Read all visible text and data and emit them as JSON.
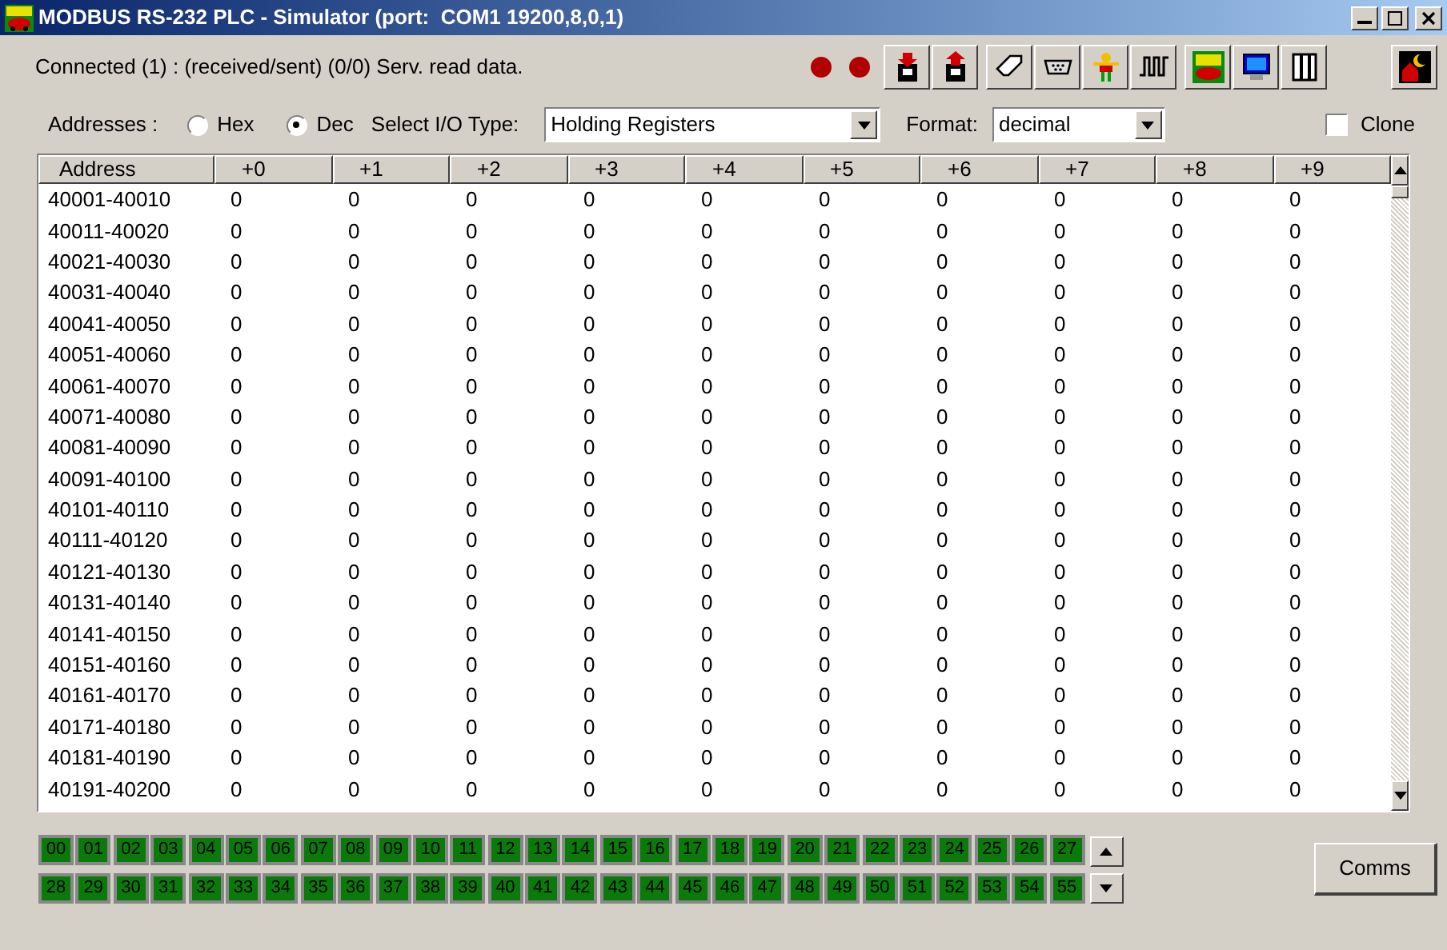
{
  "window": {
    "title": "MODBUS RS-232 PLC - Simulator (port:  COM1 19200,8,0,1)"
  },
  "status": {
    "text": "Connected (1) : (received/sent) (0/0) Serv. read data."
  },
  "options": {
    "addresses_label": "Addresses :",
    "radios": [
      {
        "label": "Hex",
        "selected": false
      },
      {
        "label": "Dec",
        "selected": true
      }
    ],
    "io_type_label": "Select I/O Type:",
    "io_type": "Holding Registers",
    "format_label": "Format:",
    "format": "decimal",
    "clone": {
      "label": "Clone",
      "checked": false
    }
  },
  "table": {
    "columns": [
      "Address",
      "+0",
      "+1",
      "+2",
      "+3",
      "+4",
      "+5",
      "+6",
      "+7",
      "+8",
      "+9"
    ],
    "rows": [
      {
        "address": "40001-40010",
        "values": [
          "0",
          "0",
          "0",
          "0",
          "0",
          "0",
          "0",
          "0",
          "0",
          "0"
        ]
      },
      {
        "address": "40011-40020",
        "values": [
          "0",
          "0",
          "0",
          "0",
          "0",
          "0",
          "0",
          "0",
          "0",
          "0"
        ]
      },
      {
        "address": "40021-40030",
        "values": [
          "0",
          "0",
          "0",
          "0",
          "0",
          "0",
          "0",
          "0",
          "0",
          "0"
        ]
      },
      {
        "address": "40031-40040",
        "values": [
          "0",
          "0",
          "0",
          "0",
          "0",
          "0",
          "0",
          "0",
          "0",
          "0"
        ]
      },
      {
        "address": "40041-40050",
        "values": [
          "0",
          "0",
          "0",
          "0",
          "0",
          "0",
          "0",
          "0",
          "0",
          "0"
        ]
      },
      {
        "address": "40051-40060",
        "values": [
          "0",
          "0",
          "0",
          "0",
          "0",
          "0",
          "0",
          "0",
          "0",
          "0"
        ]
      },
      {
        "address": "40061-40070",
        "values": [
          "0",
          "0",
          "0",
          "0",
          "0",
          "0",
          "0",
          "0",
          "0",
          "0"
        ]
      },
      {
        "address": "40071-40080",
        "values": [
          "0",
          "0",
          "0",
          "0",
          "0",
          "0",
          "0",
          "0",
          "0",
          "0"
        ]
      },
      {
        "address": "40081-40090",
        "values": [
          "0",
          "0",
          "0",
          "0",
          "0",
          "0",
          "0",
          "0",
          "0",
          "0"
        ]
      },
      {
        "address": "40091-40100",
        "values": [
          "0",
          "0",
          "0",
          "0",
          "0",
          "0",
          "0",
          "0",
          "0",
          "0"
        ]
      },
      {
        "address": "40101-40110",
        "values": [
          "0",
          "0",
          "0",
          "0",
          "0",
          "0",
          "0",
          "0",
          "0",
          "0"
        ]
      },
      {
        "address": "40111-40120",
        "values": [
          "0",
          "0",
          "0",
          "0",
          "0",
          "0",
          "0",
          "0",
          "0",
          "0"
        ]
      },
      {
        "address": "40121-40130",
        "values": [
          "0",
          "0",
          "0",
          "0",
          "0",
          "0",
          "0",
          "0",
          "0",
          "0"
        ]
      },
      {
        "address": "40131-40140",
        "values": [
          "0",
          "0",
          "0",
          "0",
          "0",
          "0",
          "0",
          "0",
          "0",
          "0"
        ]
      },
      {
        "address": "40141-40150",
        "values": [
          "0",
          "0",
          "0",
          "0",
          "0",
          "0",
          "0",
          "0",
          "0",
          "0"
        ]
      },
      {
        "address": "40151-40160",
        "values": [
          "0",
          "0",
          "0",
          "0",
          "0",
          "0",
          "0",
          "0",
          "0",
          "0"
        ]
      },
      {
        "address": "40161-40170",
        "values": [
          "0",
          "0",
          "0",
          "0",
          "0",
          "0",
          "0",
          "0",
          "0",
          "0"
        ]
      },
      {
        "address": "40171-40180",
        "values": [
          "0",
          "0",
          "0",
          "0",
          "0",
          "0",
          "0",
          "0",
          "0",
          "0"
        ]
      },
      {
        "address": "40181-40190",
        "values": [
          "0",
          "0",
          "0",
          "0",
          "0",
          "0",
          "0",
          "0",
          "0",
          "0"
        ]
      },
      {
        "address": "40191-40200",
        "values": [
          "0",
          "0",
          "0",
          "0",
          "0",
          "0",
          "0",
          "0",
          "0",
          "0"
        ]
      }
    ]
  },
  "leds": [
    "00",
    "01",
    "02",
    "03",
    "04",
    "05",
    "06",
    "07",
    "08",
    "09",
    "10",
    "11",
    "12",
    "13",
    "14",
    "15",
    "16",
    "17",
    "18",
    "19",
    "20",
    "21",
    "22",
    "23",
    "24",
    "25",
    "26",
    "27",
    "28",
    "29",
    "30",
    "31",
    "32",
    "33",
    "34",
    "35",
    "36",
    "37",
    "38",
    "39",
    "40",
    "41",
    "42",
    "43",
    "44",
    "45",
    "46",
    "47",
    "48",
    "49",
    "50",
    "51",
    "52",
    "53",
    "54",
    "55"
  ],
  "comms_button": "Comms"
}
